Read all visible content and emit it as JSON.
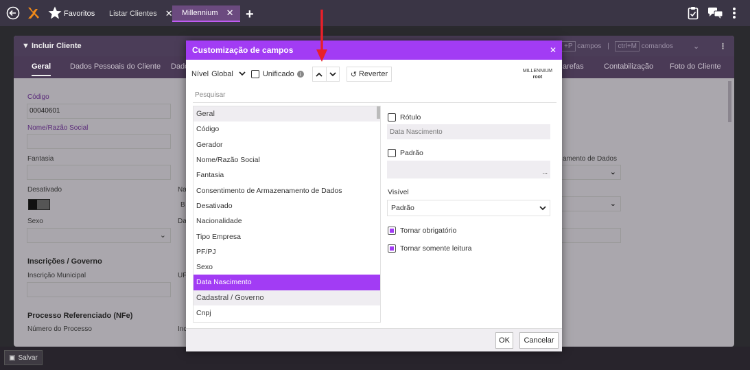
{
  "topbar": {
    "favorites_label": "Favoritos",
    "tabs": [
      {
        "label": "Listar Clientes",
        "close": "✕"
      },
      {
        "label": "Millennium",
        "close": "✕"
      }
    ],
    "add_tab": "+"
  },
  "background": {
    "panel_title": "▼ Incluir Cliente",
    "shortcuts": {
      "campos": "campos",
      "sep": "|",
      "comandos_key": "ctrl+M",
      "comandos": "comandos",
      "campos_key_partial": "+P"
    },
    "tabs": [
      "Geral",
      "Dados Pessoais do Cliente",
      "Dado",
      "arefas",
      "Contabilização",
      "Foto do Cliente"
    ],
    "fields": {
      "codigo_label": "Código",
      "codigo_value": "00040601",
      "nome_label": "Nome/Razão Social",
      "fantasia_label": "Fantasia",
      "desativado_label": "Desativado",
      "sexo_label": "Sexo",
      "na_label": "Na",
      "da_label": "Da",
      "b_value": "B",
      "armazenamento_label": "amento de Dados",
      "inscricoes_head": "Inscrições / Governo",
      "inscricao_municipal_label": "Inscrição Municipal",
      "uf_label": "UF",
      "processo_head": "Processo Referenciado (NFe)",
      "numero_processo_label": "Número do Processo",
      "inc_label": "Inc"
    },
    "save_label": "Salvar"
  },
  "modal": {
    "title": "Customização de campos",
    "close": "✕",
    "toolbar": {
      "nivel_label": "Nível",
      "nivel_value": "Global",
      "unificado_label": "Unificado",
      "reverter_label": "Reverter",
      "user_line1": "MILLENNIUM",
      "user_line2": "root"
    },
    "search_placeholder": "Pesquisar",
    "list": [
      {
        "label": "Geral",
        "kind": "group"
      },
      {
        "label": "Código",
        "kind": "item"
      },
      {
        "label": "Gerador",
        "kind": "item"
      },
      {
        "label": "Nome/Razão Social",
        "kind": "item"
      },
      {
        "label": "Fantasia",
        "kind": "item"
      },
      {
        "label": "Consentimento de Armazenamento de Dados",
        "kind": "item"
      },
      {
        "label": "Desativado",
        "kind": "item"
      },
      {
        "label": "Nacionalidade",
        "kind": "item"
      },
      {
        "label": "Tipo Empresa",
        "kind": "item"
      },
      {
        "label": "PF/PJ",
        "kind": "item"
      },
      {
        "label": "Sexo",
        "kind": "item"
      },
      {
        "label": "Data Nascimento",
        "kind": "selected"
      },
      {
        "label": "Cadastral / Governo",
        "kind": "group"
      },
      {
        "label": "Cnpj",
        "kind": "item"
      }
    ],
    "props": {
      "rotulo_label": "Rótulo",
      "rotulo_value": "Data Nascimento",
      "padrao_label": "Padrão",
      "padrao_ellipsis": "...",
      "visivel_label": "Visível",
      "visivel_value": "Padrão",
      "obrigatorio_label": "Tornar obrigatório",
      "somente_leitura_label": "Tornar somente leitura"
    },
    "ok_label": "OK",
    "cancel_label": "Cancelar"
  },
  "colors": {
    "accent": "#a23cf4",
    "annotation_arrow": "#e8202a"
  }
}
